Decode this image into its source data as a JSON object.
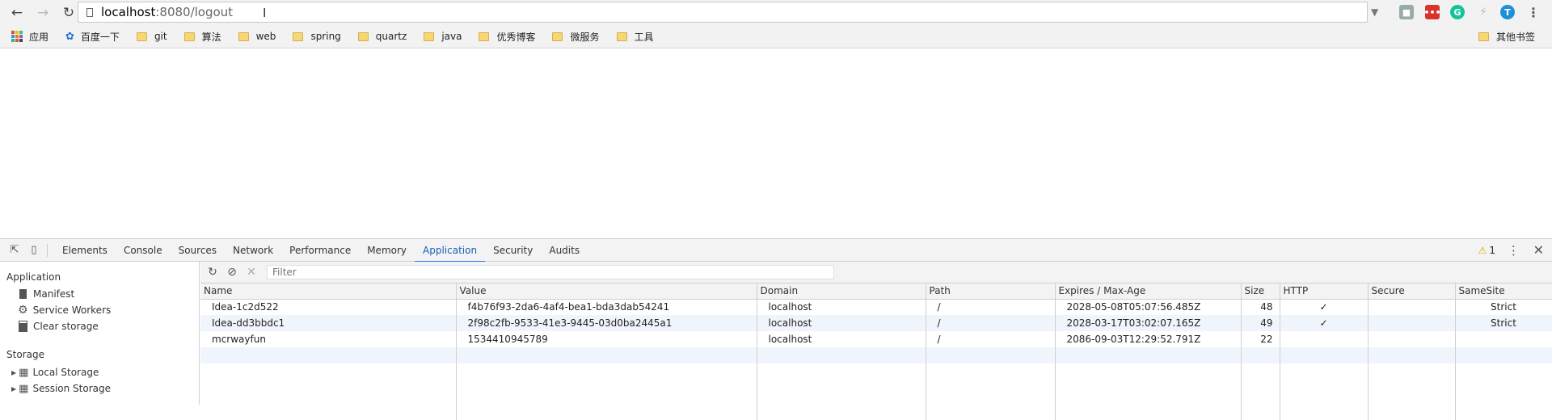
{
  "browser": {
    "url_host": "localhost",
    "url_rest": ":8080/logout",
    "bookmarks": [
      "应用",
      "百度一下",
      "git",
      "算法",
      "web",
      "spring",
      "quartz",
      "java",
      "优秀博客",
      "微服务",
      "工具"
    ],
    "other_bookmarks": "其他书签"
  },
  "devtools": {
    "tabs": [
      "Elements",
      "Console",
      "Sources",
      "Network",
      "Performance",
      "Memory",
      "Application",
      "Security",
      "Audits"
    ],
    "warning_count": "1",
    "sidebar": {
      "application_header": "Application",
      "application_items": [
        "Manifest",
        "Service Workers",
        "Clear storage"
      ],
      "storage_header": "Storage",
      "storage_items": [
        "Local Storage",
        "Session Storage"
      ]
    },
    "filter_placeholder": "Filter",
    "columns": [
      "Name",
      "Value",
      "Domain",
      "Path",
      "Expires / Max-Age",
      "Size",
      "HTTP",
      "Secure",
      "SameSite"
    ],
    "cookies": [
      {
        "name": "Idea-1c2d522",
        "value": "f4b76f93-2da6-4af4-bea1-bda3dab54241",
        "domain": "localhost",
        "path": "/",
        "expires": "2028-05-08T05:07:56.485Z",
        "size": "48",
        "http": "✓",
        "secure": "",
        "samesite": "Strict"
      },
      {
        "name": "Idea-dd3bbdc1",
        "value": "2f98c2fb-9533-41e3-9445-03d0ba2445a1",
        "domain": "localhost",
        "path": "/",
        "expires": "2028-03-17T03:02:07.165Z",
        "size": "49",
        "http": "✓",
        "secure": "",
        "samesite": "Strict"
      },
      {
        "name": "mcrwayfun",
        "value": "1534410945789",
        "domain": "localhost",
        "path": "/",
        "expires": "2086-09-03T12:29:52.791Z",
        "size": "22",
        "http": "",
        "secure": "",
        "samesite": ""
      }
    ]
  }
}
